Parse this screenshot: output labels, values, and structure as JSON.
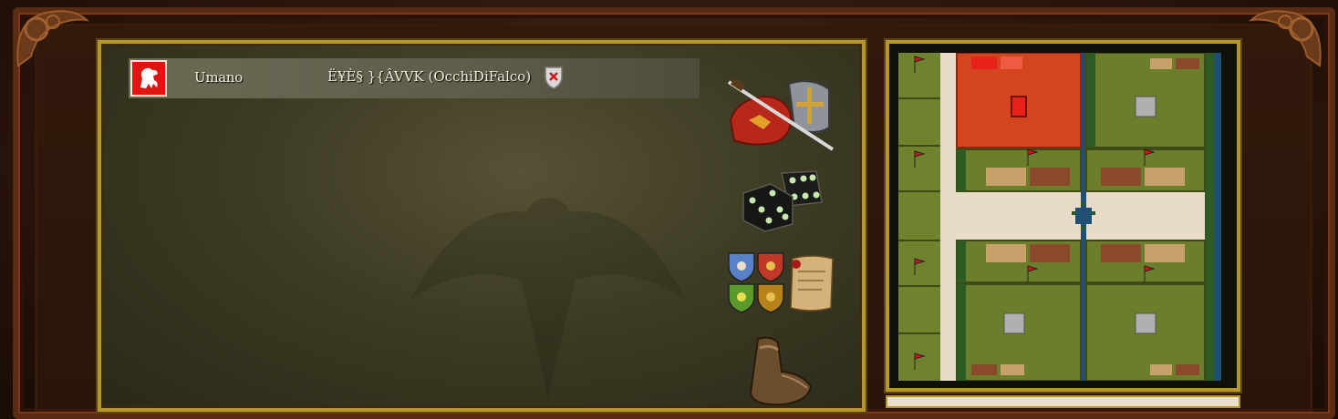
{
  "player": {
    "type": "Umano",
    "name": "Ë¥È§ }{ÂVVK (OcchiDiFalco)",
    "crest_color": "#e0150f"
  },
  "icons": {
    "kick": "kick-player-icon",
    "attack": "crossed-sword-helmet-icon",
    "dice": "dice-icon",
    "teams": "team-shields-icon",
    "scroll": "scroll-icon",
    "boot": "boot-icon"
  },
  "colors": {
    "frame_gold": "#b8962e",
    "player_red": "#e0150f",
    "map_grass": "#6a7e2c",
    "map_road": "#e8dcc8",
    "map_water": "#1f4f73",
    "map_orange": "#d2451f"
  }
}
